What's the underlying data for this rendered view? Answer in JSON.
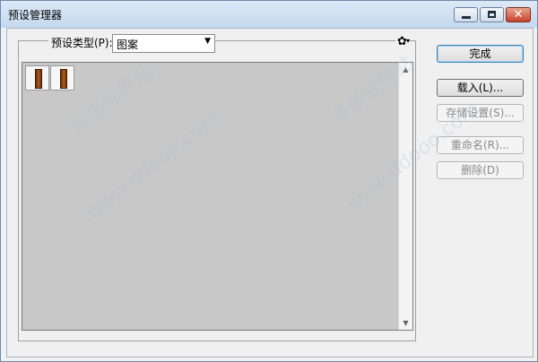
{
  "window": {
    "title": "预设管理器",
    "controls": {
      "minimize_icon": "minimize-icon",
      "maximize_icon": "maximize-icon",
      "close_icon": "close-icon",
      "close_glyph": "✕"
    }
  },
  "preset": {
    "type_label": "预设类型(P):",
    "type_value": "图案",
    "dropdown_arrow": "▼",
    "gear_icon": "gear-icon",
    "gear_glyph": "✿",
    "gear_caret": "▾"
  },
  "list": {
    "items": [
      {
        "name": "pattern-1"
      },
      {
        "name": "pattern-2"
      }
    ],
    "scroll_up_glyph": "▲",
    "scroll_down_glyph": "▼"
  },
  "buttons": {
    "done": "完成",
    "load": "载入(L)...",
    "save": "存储设置(S)...",
    "rename": "重命名(R)...",
    "delete": "删除(D)"
  },
  "watermarks": [
    "多多软件站",
    "www.ddooo.com"
  ]
}
